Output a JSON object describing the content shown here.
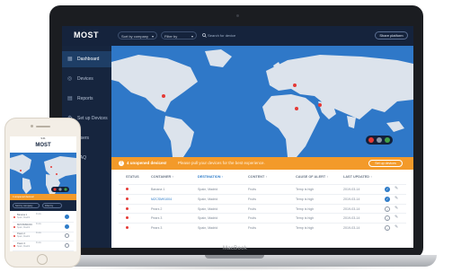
{
  "device": {
    "laptop_label": "MacBook"
  },
  "app": {
    "logo": "MOST",
    "filters": {
      "company": "Sort by company",
      "filter": "Filter by"
    },
    "search": {
      "label": "Search for device"
    },
    "share_label": "Share platform",
    "sidebar": {
      "items": [
        {
          "label": "Dashboard",
          "icon": "dashboard-icon",
          "active": true
        },
        {
          "label": "Devices",
          "icon": "devices-icon",
          "active": false
        },
        {
          "label": "Reports",
          "icon": "reports-icon",
          "active": false
        },
        {
          "label": "Set up Devices",
          "icon": "setup-icon",
          "active": false
        },
        {
          "label": "Users",
          "icon": "users-icon",
          "active": false
        },
        {
          "label": "FAQ",
          "icon": "faq-icon",
          "active": false
        }
      ]
    },
    "map_controls": [
      {
        "name": "red-alert-filter",
        "color": "#e53935"
      },
      {
        "name": "grey-filter",
        "color": "#8c96a6"
      },
      {
        "name": "green-filter",
        "color": "#43a047"
      }
    ],
    "alert": {
      "title": "4 unopened devices!",
      "message": "Please pull your devices for the best experience.",
      "button": "Set up devices"
    },
    "table": {
      "headers": [
        "STATUS",
        "CONTAINER ↑",
        "DESTINATION ↑",
        "CONTENT ↑",
        "CAUSE OF ALERT ↑",
        "LAST UPDATED ↑"
      ],
      "rows": [
        {
          "container": "Banana 1",
          "destination": "Spain, Madrid",
          "content": "Fruits",
          "cause": "Temp is high",
          "updated": "2019-03-14",
          "state": "ok",
          "highlight": false
        },
        {
          "container": "MZCSM91004",
          "destination": "Spain, Madrid",
          "content": "Fruits",
          "cause": "Temp is high",
          "updated": "2019-03-14",
          "state": "ok",
          "highlight": true
        },
        {
          "container": "Pears 2",
          "destination": "Spain, Madrid",
          "content": "Fruits",
          "cause": "Temp is high",
          "updated": "2019-03-14",
          "state": "pending",
          "highlight": false
        },
        {
          "container": "Pears 3",
          "destination": "Spain, Madrid",
          "content": "Fruits",
          "cause": "Temp is high",
          "updated": "2019-03-14",
          "state": "pending",
          "highlight": false
        },
        {
          "container": "Pears 3",
          "destination": "Spain, Madrid",
          "content": "Fruits",
          "cause": "Temp is high",
          "updated": "2019-03-14",
          "state": "pending",
          "highlight": false
        }
      ]
    },
    "colors": {
      "navy": "#14233b",
      "orange": "#f39a2a",
      "map_blue": "#2f78c8",
      "alert_red": "#e53935",
      "ok_blue": "#2e7cc8"
    }
  },
  "phone": {
    "status_time": "9:41",
    "logo": "MOST",
    "alert_text": "4 unopened devices!",
    "filters": {
      "company": "Sort by company",
      "filter": "Filter by"
    },
    "rows": [
      {
        "name": "Banana 1",
        "place": "Spain, Madrid",
        "content": "Fruits",
        "state": "ok"
      },
      {
        "name": "MZCSM91004",
        "place": "Spain, Madrid",
        "content": "Fruits",
        "state": "ok"
      },
      {
        "name": "Pears 2",
        "place": "Spain, Madrid",
        "content": "Fruits",
        "state": "pending"
      },
      {
        "name": "Pears 3",
        "place": "Spain, Madrid",
        "content": "Fruits",
        "state": "pending"
      }
    ]
  }
}
